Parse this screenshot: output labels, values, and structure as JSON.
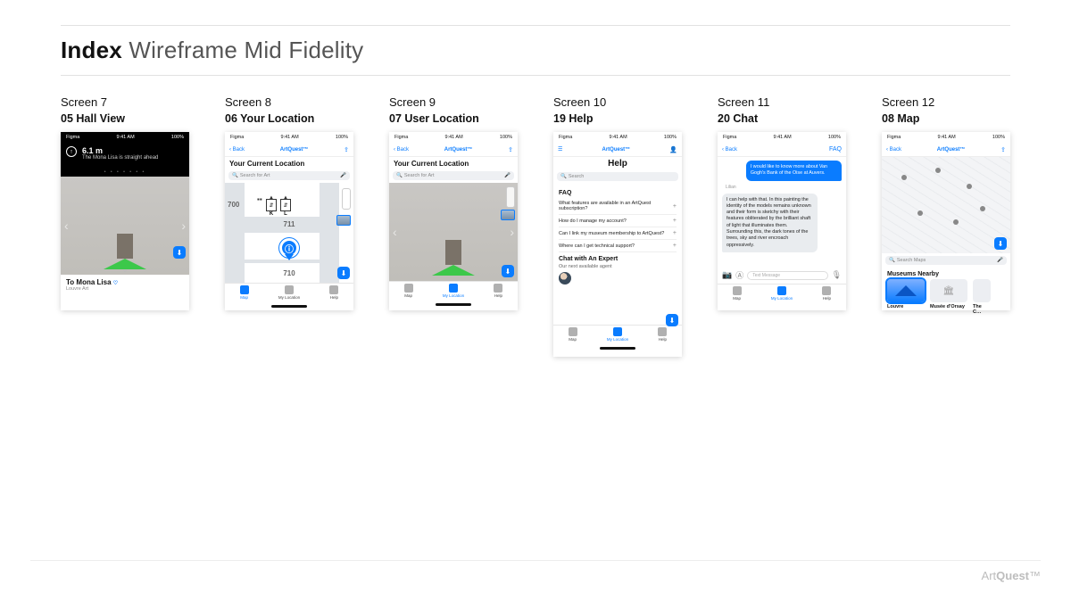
{
  "page": {
    "title_bold": "Index",
    "title_rest": " Wireframe Mid Fidelity"
  },
  "brand": {
    "name": "ArtQuest",
    "suffix": "™"
  },
  "status": {
    "left": "Figma",
    "time": "9:41 AM",
    "battery": "100%"
  },
  "nav": {
    "back": "‹ Back",
    "brand": "ArtQuest™",
    "share": "⇪",
    "profile": "profile",
    "faq": "FAQ",
    "menu": "☰"
  },
  "tabs": {
    "map": "Map",
    "my_location": "My Location",
    "help": "Help"
  },
  "fab": {
    "glyph": "⬇",
    "label": "Get app"
  },
  "search": {
    "placeholder_art": "Search for Art",
    "placeholder_generic": "Search",
    "placeholder_maps": "Search Maps",
    "mic": "🎤"
  },
  "screens": [
    {
      "id": "s7",
      "label": "Screen 7",
      "name": "05 Hall View",
      "hall": {
        "distance": "6.1 m",
        "hint": "The Mona Lisa is straight ahead",
        "footer_title": "To Mona Lisa",
        "footer_meta": "Louvre Art"
      }
    },
    {
      "id": "s8",
      "label": "Screen 8",
      "name": "06 Your Location",
      "heading": "Your Current Location",
      "rooms": {
        "top": "700",
        "mid": "711",
        "bottom": "710"
      },
      "elevators": {
        "left": "K",
        "right": "L"
      }
    },
    {
      "id": "s9",
      "label": "Screen 9",
      "name": "07 User Location",
      "heading": "Your Current Location"
    },
    {
      "id": "s10",
      "label": "Screen 10",
      "name": "19 Help",
      "heading": "Help",
      "faq_title": "FAQ",
      "faqs": [
        "What features are available in an ArtQuest subscription?",
        "How do I manage my account?",
        "Can I link my museum membership to ArtQuest?",
        "Where can I get technical support?"
      ],
      "chat_title": "Chat with An Expert",
      "chat_sub": "Our next available agent"
    },
    {
      "id": "s11",
      "label": "Screen 11",
      "name": "20 Chat",
      "me_msg": "I would like to know more about Van Gogh's Bank of the Oise at Auvers.",
      "sender": "Lilian",
      "them_msg": "I can help with that. In this painting the identity of the models remains unknown and their form is sketchy with their features obliterated by the brilliant shaft of light that illuminates them. Surrounding this, the dark tones of the trees, sky and river encroach oppressively.",
      "composer_placeholder": "Text Message"
    },
    {
      "id": "s12",
      "label": "Screen 12",
      "name": "08 Map",
      "section": "Museums Nearby",
      "museums": [
        "Louvre",
        "Musée d'Orsay",
        "The C…"
      ]
    }
  ]
}
